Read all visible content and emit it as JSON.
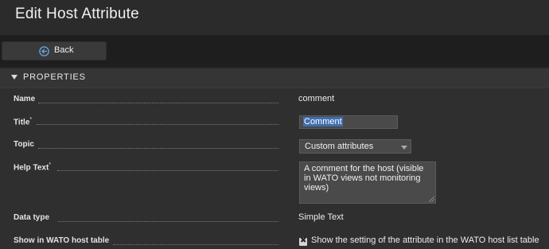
{
  "header": {
    "title": "Edit Host Attribute"
  },
  "toolbar": {
    "back_label": "Back",
    "back_icon": "back-circle-arrow-icon"
  },
  "section": {
    "label": "PROPERTIES"
  },
  "fields": {
    "name": {
      "label": "Name",
      "value": "comment"
    },
    "title": {
      "label": "Title",
      "required_mark": "*",
      "value": "Comment"
    },
    "topic": {
      "label": "Topic",
      "value": "Custom attributes"
    },
    "help_text": {
      "label": "Help Text",
      "required_mark": "*",
      "value": "A comment for the host (visible in WATO views not monitoring views)"
    },
    "data_type": {
      "label": "Data type",
      "value": "Simple Text"
    },
    "show_in_table": {
      "label": "Show in WATO host table",
      "checked": true,
      "option_label": "Show the setting of the attribute in the WATO host list table"
    }
  },
  "colors": {
    "accent": "#3e6fb0",
    "background": "#262626",
    "panel": "#2f2f2f"
  }
}
